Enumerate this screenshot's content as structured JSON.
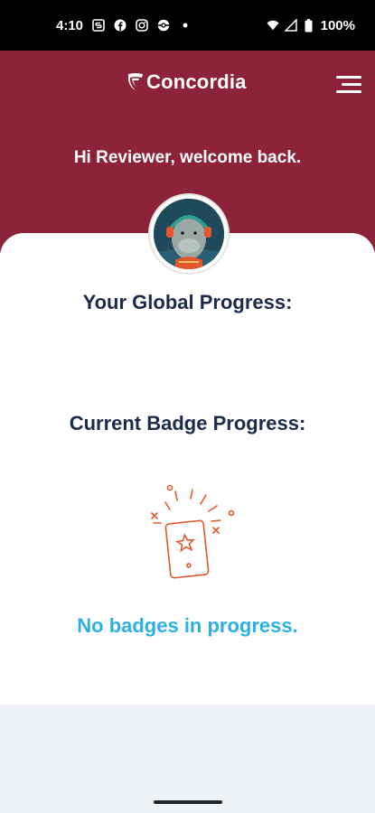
{
  "status_bar": {
    "time": "4:10",
    "battery": "100%",
    "icons": [
      "s-icon",
      "facebook-icon",
      "instagram-icon",
      "pokeball-icon",
      "dot-icon",
      "wifi-icon",
      "signal-icon",
      "battery-icon"
    ]
  },
  "header": {
    "brand": "Concordia",
    "greeting": "Hi Reviewer, welcome back.",
    "background_color": "#8d2339"
  },
  "main": {
    "global_progress_title": "Your Global Progress:",
    "badge_progress_title": "Current Badge Progress:",
    "empty_state": "No badges in progress.",
    "accent_color": "#2bb0e6",
    "illustration_color": "#e4572e"
  }
}
